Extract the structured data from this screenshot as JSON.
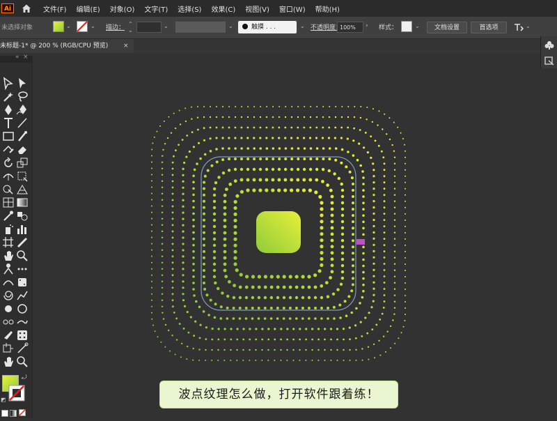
{
  "app": {
    "logo_text": "Ai"
  },
  "menu": [
    "文件(F)",
    "编辑(E)",
    "对象(O)",
    "文字(T)",
    "选择(S)",
    "效果(C)",
    "视图(V)",
    "窗口(W)",
    "帮助(H)"
  ],
  "control_bar": {
    "selection_status": "未选择对象",
    "stroke_label": "描边：",
    "brush_label": "触摸 . . .",
    "opacity_label": "不透明度：",
    "opacity_value": "100%",
    "style_label": "样式：",
    "doc_settings": "文档设置",
    "preferences": "首选项"
  },
  "document_tab": {
    "title": "未标题-1* @ 200 % (RGB/CPU 预览)",
    "close": "×"
  },
  "caption": "波点纹理怎么做，打开软件跟着练！",
  "colors": {
    "fill_gradient_start": "#e8ef3a",
    "fill_gradient_end": "#8fcc3a",
    "path_outline": "#7fa0b8",
    "anchor_label": "#c050c8"
  }
}
